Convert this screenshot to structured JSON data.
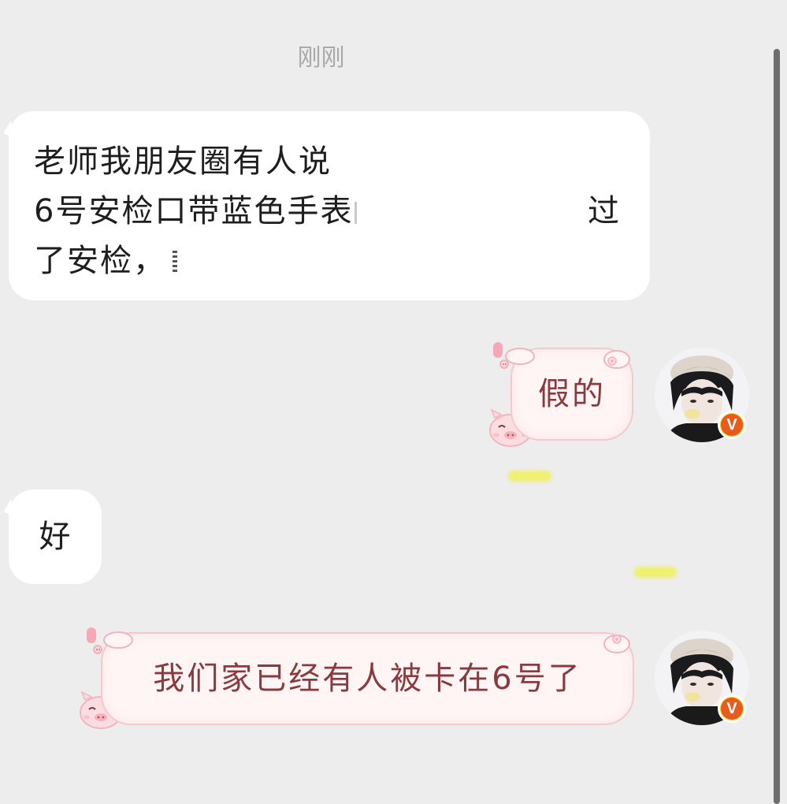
{
  "timestamp": "刚刚",
  "messages": [
    {
      "side": "left",
      "lines": [
        "老师我朋友圈有人说",
        "6号安检口带蓝色手表",
        "了安检，"
      ],
      "line2_end": "过"
    },
    {
      "side": "right",
      "text": "假的",
      "style": "pink-pig-bubble"
    },
    {
      "side": "left",
      "text": "好"
    },
    {
      "side": "right",
      "text": "我们家已经有人被卡在6号了",
      "style": "pink-pig-bubble"
    }
  ],
  "badges": {
    "vip": "V"
  },
  "colors": {
    "background": "#ededed",
    "left_bubble": "#ffffff",
    "right_bubble": "#fff5f5",
    "right_text": "#8a3a3e",
    "badge": "#f7d21e"
  }
}
